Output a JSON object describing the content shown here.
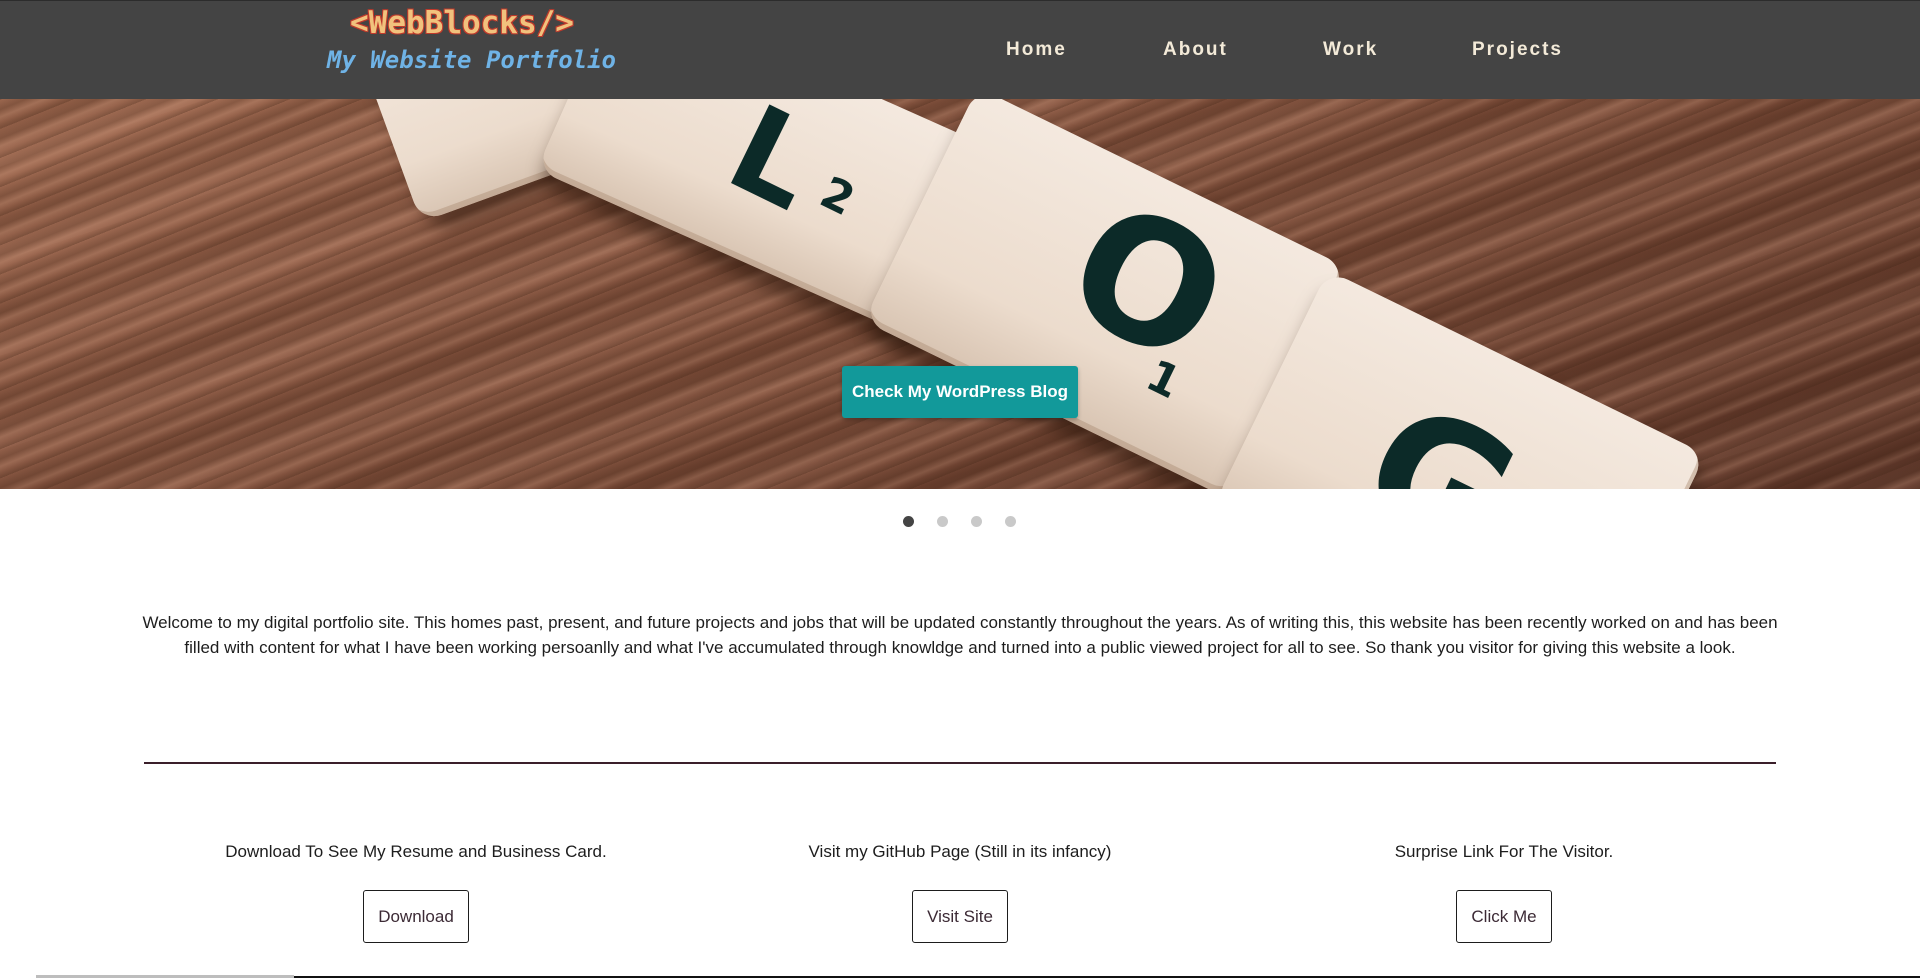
{
  "brand": {
    "logo": "<WebBlocks/>",
    "subtitle": "My Website Portfolio"
  },
  "nav": {
    "items": [
      "Home",
      "About",
      "Work",
      "Projects"
    ]
  },
  "hero": {
    "button_label": "Check My WordPress Blog",
    "slides_count": 4,
    "active_slide": 1
  },
  "intro": {
    "text": "Welcome to my digital portfolio site. This homes past, present, and future projects and jobs that will be updated constantly throughout the years. As of writing this, this website has been recently worked on and has been filled with content for what I have been working persoanlly and what I've accumulated through knowldge and turned into a public viewed project for all to see. So thank you visitor for giving this website a look."
  },
  "links": [
    {
      "text": "Download To See My Resume and Business Card.",
      "button": "Download"
    },
    {
      "text": "Visit my GitHub Page (Still in its infancy)",
      "button": "Visit Site"
    },
    {
      "text": "Surprise Link For The Visitor.",
      "button": "Click Me"
    }
  ],
  "colors": {
    "header_bg": "#444444",
    "accent": "#12999a",
    "logo": "#f1c27d",
    "subtitle": "#6fb3e6"
  }
}
